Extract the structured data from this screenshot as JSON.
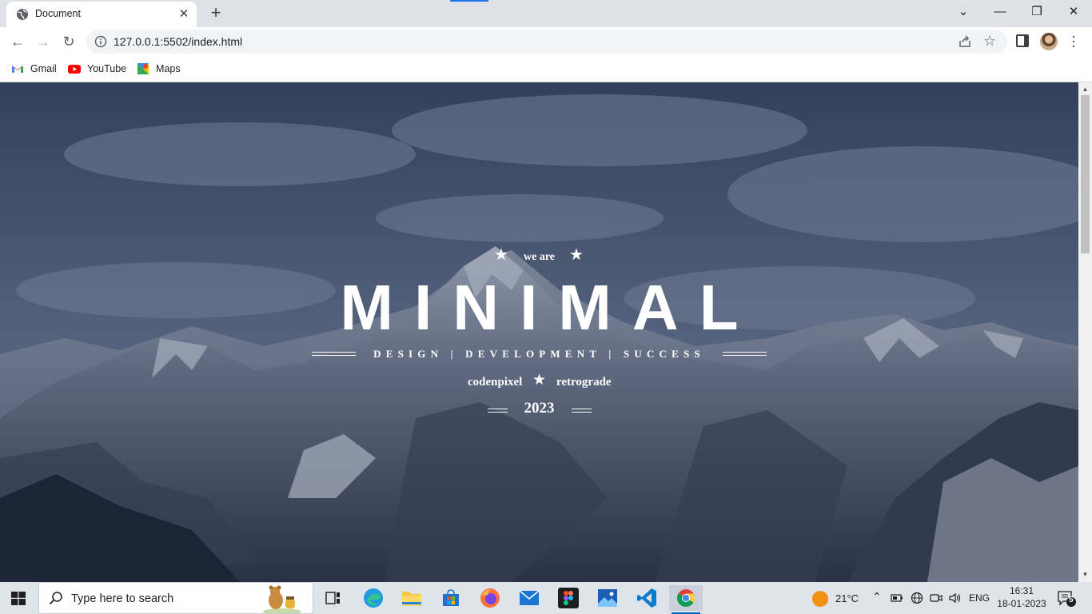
{
  "browser": {
    "tab_title": "Document",
    "url": "127.0.0.1:5502/index.html",
    "bookmarks": [
      {
        "label": "Gmail",
        "icon": "gmail-icon"
      },
      {
        "label": "YouTube",
        "icon": "youtube-icon"
      },
      {
        "label": "Maps",
        "icon": "maps-icon"
      }
    ]
  },
  "hero": {
    "intro": "we are",
    "title": "MINIMAL",
    "tagline": "DESIGN | DEVELOPMENT | SUCCESS",
    "author_left": "codenpixel",
    "author_right": "retrograde",
    "year": "2023"
  },
  "taskbar": {
    "search_placeholder": "Type here to search",
    "apps": [
      "task-view",
      "edge",
      "file-explorer",
      "microsoft-store",
      "firefox",
      "mail",
      "figma",
      "photos",
      "vscode",
      "chrome"
    ],
    "weather": "21°C",
    "language": "ENG",
    "time": "16:31",
    "date": "18-01-2023",
    "notification_count": "5"
  },
  "colors": {
    "tab_strip": "#dee1e6",
    "taskbar": "#dfe3ea",
    "accent": "#1a73e8"
  }
}
